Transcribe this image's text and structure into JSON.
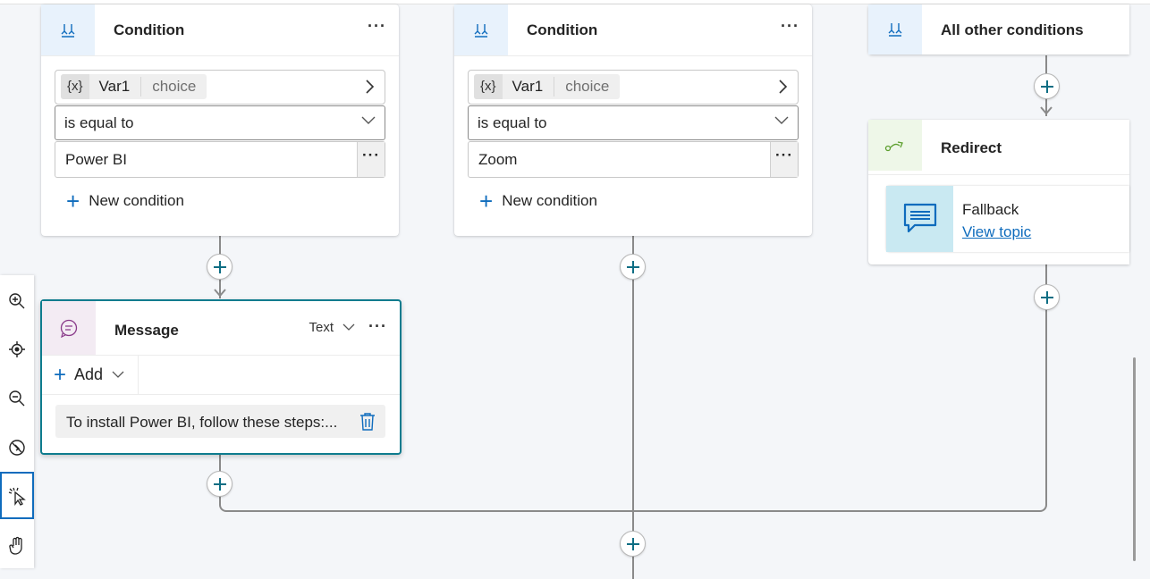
{
  "conditions": [
    {
      "title": "Condition",
      "var_token": "{x}",
      "var_name": "Var1",
      "var_type": "choice",
      "operator": "is equal to",
      "value": "Power BI",
      "new_condition_label": "New condition",
      "more_label": "···"
    },
    {
      "title": "Condition",
      "var_token": "{x}",
      "var_name": "Var1",
      "var_type": "choice",
      "operator": "is equal to",
      "value": "Zoom",
      "new_condition_label": "New condition",
      "more_label": "···"
    }
  ],
  "other_conditions": {
    "title": "All other conditions"
  },
  "redirect": {
    "title": "Redirect",
    "topic_name": "Fallback",
    "topic_link": "View topic"
  },
  "message": {
    "title": "Message",
    "type_label": "Text",
    "more_label": "···",
    "add_label": "Add",
    "text": "To install Power BI, follow these steps:..."
  },
  "toolbar": {
    "items": [
      "zoom-in-icon",
      "recenter-icon",
      "zoom-out-icon",
      "hide-minimap-icon",
      "select-pointer-icon",
      "pan-hand-icon"
    ],
    "active_item": "select-pointer-icon"
  },
  "colors": {
    "accent": "#0f6cbd",
    "condition_icon_bg": "#e8f2fc",
    "message_icon_bg": "#f3ebf3",
    "redirect_icon_bg": "#eef7e8",
    "topic_icon_bg": "#c9e9f2",
    "message_border": "#0e7c8e"
  }
}
